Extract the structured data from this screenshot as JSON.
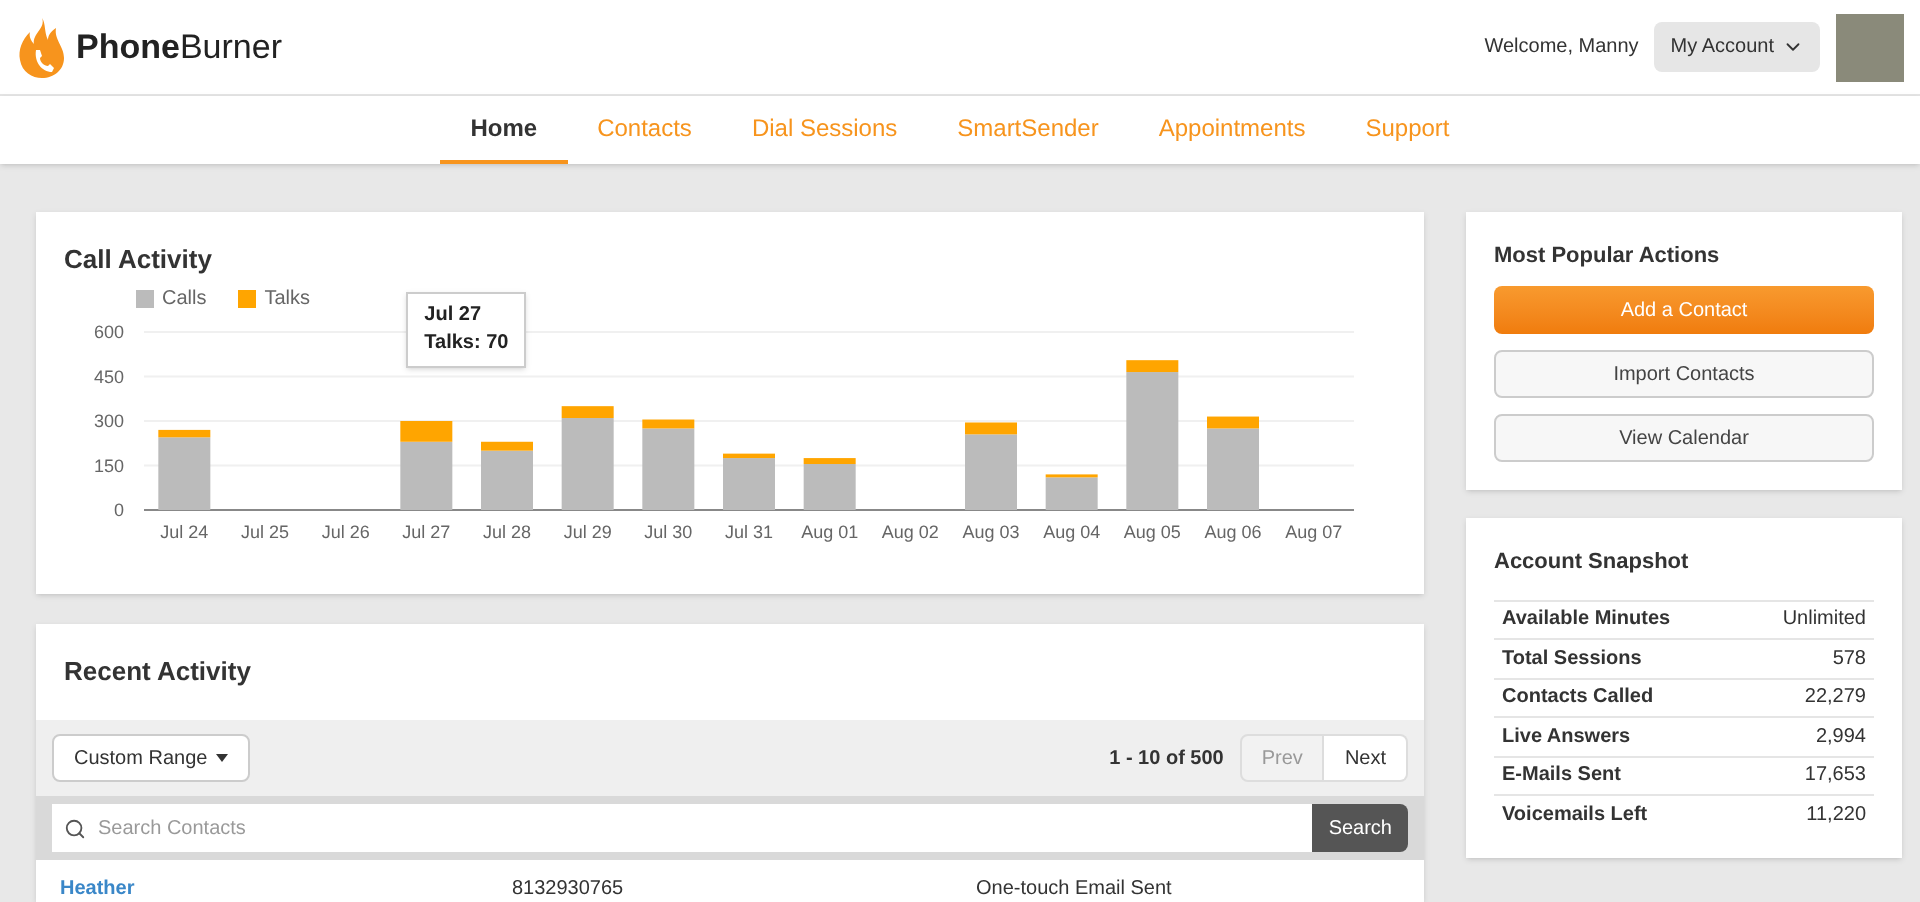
{
  "header": {
    "logo": "**Phone**Burner",
    "welcome": "Welcome, Manny",
    "account_button": "My Account"
  },
  "nav": [
    {
      "label": "Home",
      "selected": true
    },
    {
      "label": "Contacts",
      "selected": false
    },
    {
      "label": "Dial Sessions",
      "selected": false
    },
    {
      "label": "SmartSender",
      "selected": false
    },
    {
      "label": "Appointments",
      "selected": false
    },
    {
      "label": "Support",
      "selected": false
    }
  ],
  "call_activity": {
    "title": "Call Activity",
    "chart_data": {
      "type": "bar",
      "stacked": true,
      "categories": [
        "Jul 24",
        "Jul 25",
        "Jul 26",
        "Jul 27",
        "Jul 28",
        "Jul 29",
        "Jul 30",
        "Jul 31",
        "Aug 01",
        "Aug 02",
        "Aug 03",
        "Aug 04",
        "Aug 05",
        "Aug 06",
        "Aug 07"
      ],
      "series": [
        {
          "name": "Calls",
          "color": "#bbbbbb",
          "values": [
            245,
            0,
            0,
            230,
            200,
            310,
            275,
            175,
            155,
            0,
            255,
            110,
            465,
            275,
            0
          ]
        },
        {
          "name": "Talks",
          "color": "#ffa500",
          "values": [
            25,
            0,
            0,
            70,
            30,
            40,
            30,
            15,
            20,
            0,
            40,
            10,
            40,
            40,
            0
          ]
        }
      ],
      "ylim": [
        0,
        600
      ],
      "yticks": [
        0,
        150,
        300,
        450,
        600
      ],
      "grid": true,
      "legend": "top",
      "annotations": [
        "Jul 27\nTalks: 70"
      ]
    }
  },
  "recent_activity": {
    "title": "Recent Activity",
    "range_button": "Custom Range",
    "pagination": "1 - 10 of 500",
    "prev": {
      "label": "Prev",
      "disabled": true
    },
    "next": {
      "label": "Next",
      "disabled": false
    },
    "search": {
      "placeholder": "Search Contacts",
      "button": "Search"
    },
    "rows": [
      {
        "name": "Heather",
        "phone": "8132930765",
        "activity": "One-touch Email Sent"
      }
    ]
  },
  "popular_actions": {
    "title": "Most Popular Actions",
    "buttons": [
      {
        "label": "Add a Contact",
        "kind": "primary"
      },
      {
        "label": "Import Contacts",
        "kind": "default"
      },
      {
        "label": "View Calendar",
        "kind": "default"
      }
    ]
  },
  "snapshot": {
    "title": "Account Snapshot",
    "rows": [
      {
        "label": "Available Minutes",
        "value": "Unlimited"
      },
      {
        "label": "Total Sessions",
        "value": "578"
      },
      {
        "label": "Contacts Called",
        "value": "22,279"
      },
      {
        "label": "Live Answers",
        "value": "2,994"
      },
      {
        "label": "E-Mails Sent",
        "value": "17,653"
      },
      {
        "label": "Voicemails Left",
        "value": "11,220"
      }
    ]
  }
}
